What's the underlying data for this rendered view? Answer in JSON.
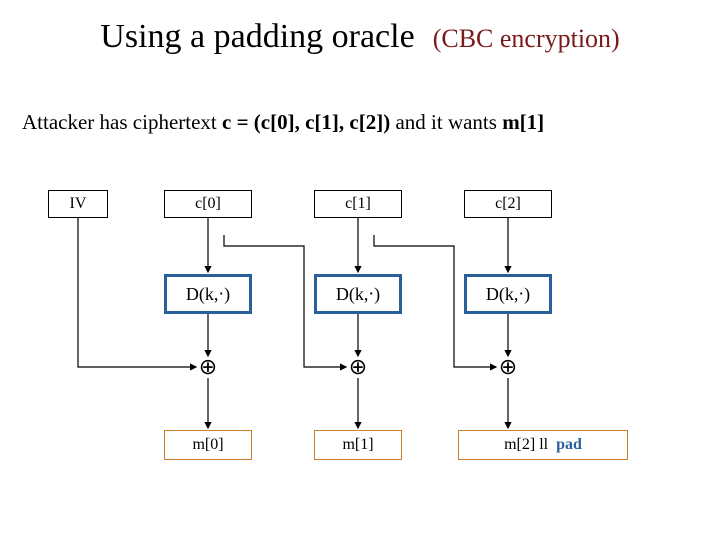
{
  "title": {
    "main": "Using a padding oracle",
    "sub": "(CBC encryption)"
  },
  "description": {
    "prefix": "Attacker has ciphertext  ",
    "cipher": "c = (c[0], c[1], c[2])",
    "middle": "   and it wants  ",
    "target": "m[1]"
  },
  "diagram": {
    "iv": "IV",
    "c0": "c[0]",
    "c1": "c[1]",
    "c2": "c[2]",
    "dk": "D(k,⋅)",
    "xor": "⊕",
    "m0": "m[0]",
    "m1": "m[1]",
    "m2": "m[2]  ll",
    "pad": "pad"
  }
}
